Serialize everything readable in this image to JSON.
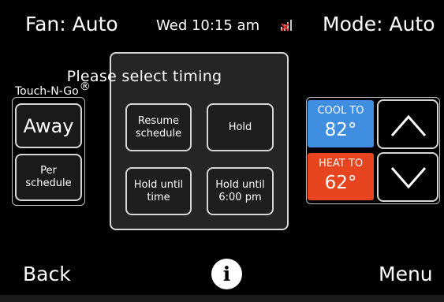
{
  "header": {
    "fan": "Fan: Auto",
    "datetime": "Wed 10:15 am",
    "mode": "Mode: Auto",
    "signal_icon": "no-wifi-signal-icon"
  },
  "brand": {
    "name": "Touch-N-Go",
    "reg": "®"
  },
  "left_buttons": {
    "away": "Away",
    "per_schedule_line1": "Per",
    "per_schedule_line2": "schedule"
  },
  "modal": {
    "title": "Please select timing",
    "resume_line1": "Resume",
    "resume_line2": "schedule",
    "hold": "Hold",
    "hold_until_time_line1": "Hold until",
    "hold_until_time_line2": "time",
    "hold_until_600_line1": "Hold until",
    "hold_until_600_line2": "6:00 pm"
  },
  "setpoints": {
    "cool_label": "COOL TO",
    "cool_value": "82°",
    "heat_label": "HEAT TO",
    "heat_value": "62°"
  },
  "footer": {
    "back": "Back",
    "info": "i",
    "menu": "Menu"
  },
  "colors": {
    "cool": "#3f8ee0",
    "heat": "#e6451f",
    "modal_bg": "#252525",
    "button_border": "#d6d6d6"
  }
}
